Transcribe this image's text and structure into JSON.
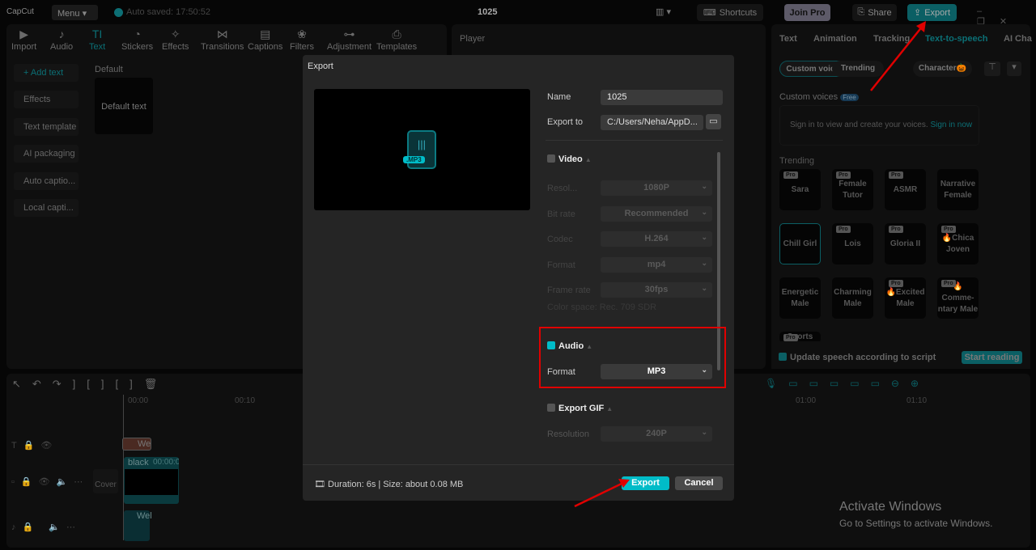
{
  "app": {
    "logo": "CapCut",
    "menu": "Menu",
    "autosave": "Auto saved: 17:50:52",
    "project": "1025"
  },
  "topbar": {
    "shortcuts": "Shortcuts",
    "join_pro": "Join Pro",
    "share": "Share",
    "export": "Export"
  },
  "toolbar": [
    "Import",
    "Audio",
    "Text",
    "Stickers",
    "Effects",
    "Transitions",
    "Captions",
    "Filters",
    "Adjustment",
    "Templates"
  ],
  "left_menu": [
    "+ Add text",
    "Effects",
    "Text template",
    "AI packaging",
    "Auto captio...",
    "Local capti..."
  ],
  "text_panel": {
    "section": "Default",
    "item": "Default text"
  },
  "player": {
    "title": "Player"
  },
  "right_tabs": [
    "Text",
    "Animation",
    "Tracking",
    "Text-to-speech",
    "AI Cha"
  ],
  "tts": {
    "chips": [
      "Custom voices",
      "Trending",
      "Character🎃"
    ],
    "custom_voices_label": "Custom voices",
    "free_badge": "Free",
    "signin_text": "Sign in to view and create your voices.",
    "signin_link": "Sign in now",
    "trending_label": "Trending",
    "voices": [
      {
        "name": "Sara",
        "pro": "Pro"
      },
      {
        "name": "Female Tutor",
        "pro": "Pro"
      },
      {
        "name": "ASMR",
        "pro": "Pro"
      },
      {
        "name": "Narrative Female"
      },
      {
        "name": "Chill Girl"
      },
      {
        "name": "Lois",
        "pro": "Pro"
      },
      {
        "name": "Gloria II",
        "pro": "Pro"
      },
      {
        "name": "🔥Chica Joven",
        "pro": "Pro"
      },
      {
        "name": "Energetic Male"
      },
      {
        "name": "Charming Male"
      },
      {
        "name": "🔥Excited Male",
        "pro": "Pro"
      },
      {
        "name": "🔥Comme-ntary Male",
        "pro": "Pro"
      },
      {
        "name": "Sports",
        "pro": "Pro"
      }
    ],
    "update_label": "Update speech according to script",
    "start_reading": "Start reading"
  },
  "timeline": {
    "ticks": [
      "00:00",
      "00:10",
      "01:00",
      "01:10"
    ],
    "text_clip": "We",
    "video_clip_name": "black",
    "video_clip_time": "00:00:0",
    "audio_clip": "Wel",
    "cover": "Cover"
  },
  "dialog": {
    "title": "Export",
    "file_badge": ".MP3",
    "name_label": "Name",
    "name_value": "1025",
    "export_to_label": "Export to",
    "export_to_value": "C:/Users/Neha/AppD...",
    "video": {
      "label": "Video",
      "checked": false,
      "rows": [
        {
          "label": "Resol...",
          "value": "1080P"
        },
        {
          "label": "Bit rate",
          "value": "Recommended"
        },
        {
          "label": "Codec",
          "value": "H.264"
        },
        {
          "label": "Format",
          "value": "mp4"
        },
        {
          "label": "Frame rate",
          "value": "30fps"
        }
      ],
      "color_space": "Color space: Rec. 709 SDR"
    },
    "audio": {
      "label": "Audio",
      "checked": true,
      "format_label": "Format",
      "format_value": "MP3"
    },
    "gif": {
      "label": "Export GIF",
      "checked": false,
      "resolution_label": "Resolution",
      "resolution_value": "240P"
    },
    "footer": {
      "info": "Duration: 6s | Size: about 0.08 MB",
      "export": "Export",
      "cancel": "Cancel"
    }
  },
  "watermark": {
    "title": "Activate Windows",
    "subtitle": "Go to Settings to activate Windows."
  },
  "colors": {
    "accent": "#00bcc8",
    "highlight": "#e00000"
  }
}
